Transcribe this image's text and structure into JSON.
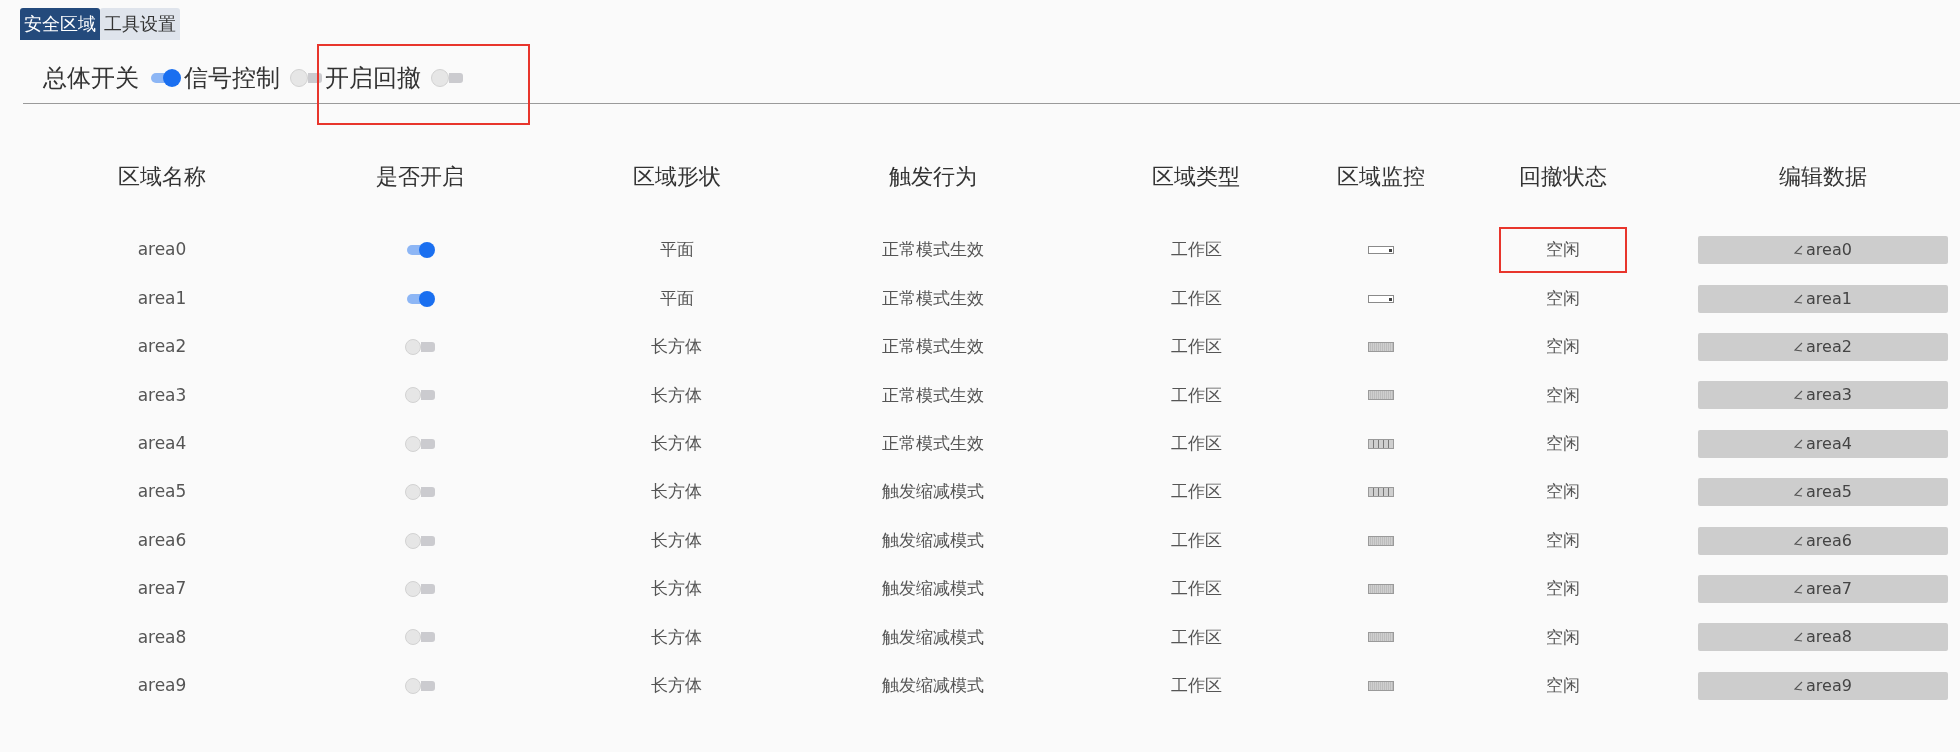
{
  "tabs": [
    {
      "label": "安全区域",
      "selected": true
    },
    {
      "label": "工具设置",
      "selected": false
    }
  ],
  "switches": [
    {
      "label": "总体开关",
      "on": true,
      "highlighted": false
    },
    {
      "label": "信号控制",
      "on": false,
      "highlighted": false
    },
    {
      "label": "开启回撤",
      "on": false,
      "highlighted": true
    }
  ],
  "table": {
    "columns": [
      "区域名称",
      "是否开启",
      "区域形状",
      "触发行为",
      "区域类型",
      "区域监控",
      "回撤状态",
      "编辑数据"
    ],
    "rows": [
      {
        "name": "area0",
        "enabled": true,
        "shape": "平面",
        "trigger": "正常模式生效",
        "type": "工作区",
        "monitor": {
          "kind": "outline"
        },
        "status": "空闲",
        "status_highlighted": true,
        "edit": "area0"
      },
      {
        "name": "area1",
        "enabled": true,
        "shape": "平面",
        "trigger": "正常模式生效",
        "type": "工作区",
        "monitor": {
          "kind": "outline"
        },
        "status": "空闲",
        "status_highlighted": false,
        "edit": "area1"
      },
      {
        "name": "area2",
        "enabled": false,
        "shape": "长方体",
        "trigger": "正常模式生效",
        "type": "工作区",
        "monitor": {
          "kind": "striped"
        },
        "status": "空闲",
        "status_highlighted": false,
        "edit": "area2"
      },
      {
        "name": "area3",
        "enabled": false,
        "shape": "长方体",
        "trigger": "正常模式生效",
        "type": "工作区",
        "monitor": {
          "kind": "striped"
        },
        "status": "空闲",
        "status_highlighted": false,
        "edit": "area3"
      },
      {
        "name": "area4",
        "enabled": false,
        "shape": "长方体",
        "trigger": "正常模式生效",
        "type": "工作区",
        "monitor": {
          "kind": "segmented"
        },
        "status": "空闲",
        "status_highlighted": false,
        "edit": "area4"
      },
      {
        "name": "area5",
        "enabled": false,
        "shape": "长方体",
        "trigger": "触发缩减模式",
        "type": "工作区",
        "monitor": {
          "kind": "segmented"
        },
        "status": "空闲",
        "status_highlighted": false,
        "edit": "area5"
      },
      {
        "name": "area6",
        "enabled": false,
        "shape": "长方体",
        "trigger": "触发缩减模式",
        "type": "工作区",
        "monitor": {
          "kind": "striped"
        },
        "status": "空闲",
        "status_highlighted": false,
        "edit": "area6"
      },
      {
        "name": "area7",
        "enabled": false,
        "shape": "长方体",
        "trigger": "触发缩减模式",
        "type": "工作区",
        "monitor": {
          "kind": "striped"
        },
        "status": "空闲",
        "status_highlighted": false,
        "edit": "area7"
      },
      {
        "name": "area8",
        "enabled": false,
        "shape": "长方体",
        "trigger": "触发缩减模式",
        "type": "工作区",
        "monitor": {
          "kind": "striped"
        },
        "status": "空闲",
        "status_highlighted": false,
        "edit": "area8"
      },
      {
        "name": "area9",
        "enabled": false,
        "shape": "长方体",
        "trigger": "触发缩减模式",
        "type": "工作区",
        "monitor": {
          "kind": "striped"
        },
        "status": "空闲",
        "status_highlighted": false,
        "edit": "area9"
      }
    ]
  }
}
